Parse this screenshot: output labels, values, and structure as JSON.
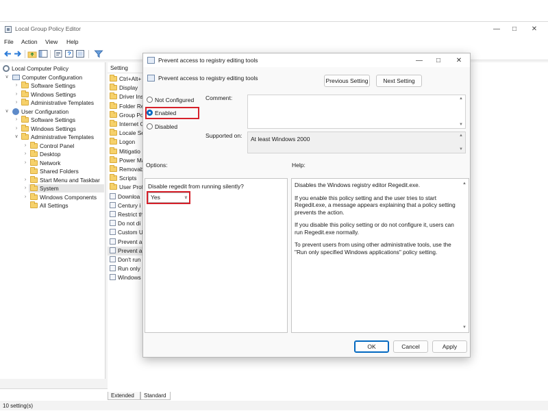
{
  "window": {
    "title": "Local Group Policy Editor",
    "menus": [
      "File",
      "Action",
      "View",
      "Help"
    ],
    "status": "10 setting(s)"
  },
  "tree": {
    "root": "Local Computer Policy",
    "computer": "Computer Configuration",
    "computer_children": [
      "Software Settings",
      "Windows Settings",
      "Administrative Templates"
    ],
    "user": "User Configuration",
    "user_children": [
      "Software Settings",
      "Windows Settings",
      "Administrative Templates"
    ],
    "admin_children": [
      "Control Panel",
      "Desktop",
      "Network",
      "Shared Folders",
      "Start Menu and Taskbar",
      "System",
      "Windows Components",
      "All Settings"
    ]
  },
  "list": {
    "header": "Setting",
    "folders": [
      "Ctrl+Alt+",
      "Display",
      "Driver Ins",
      "Folder Re",
      "Group Po",
      "Internet C",
      "Locale Se",
      "Logon",
      "Mitigatio",
      "Power Ma",
      "Removab",
      "Scripts",
      "User Profi"
    ],
    "settings": [
      "Downloa",
      "Century i",
      "Restrict th",
      "Do not di",
      "Custom U",
      "Prevent a",
      "Prevent a",
      "Don't run",
      "Run only",
      "Windows"
    ]
  },
  "tabs": [
    "Extended",
    "Standard"
  ],
  "dialog": {
    "title": "Prevent access to registry editing tools",
    "header_label": "Prevent access to registry editing tools",
    "prev_button": "Previous Setting",
    "next_button": "Next Setting",
    "radio_not_configured": "Not Configured",
    "radio_enabled": "Enabled",
    "radio_disabled": "Disabled",
    "comment_label": "Comment:",
    "supported_label": "Supported on:",
    "supported_value": "At least Windows 2000",
    "options_label": "Options:",
    "help_label": "Help:",
    "option_text": "Disable regedit from running silently?",
    "option_value": "Yes",
    "help_paragraphs": [
      "Disables the Windows registry editor Regedit.exe.",
      "If you enable this policy setting and the user tries to start Regedit.exe, a message appears explaining that a policy setting prevents the action.",
      "If you disable this policy setting or do not configure it, users can run Regedit.exe normally.",
      "To prevent users from using other administrative tools, use the \"Run only specified Windows applications\" policy setting."
    ],
    "ok": "OK",
    "cancel": "Cancel",
    "apply": "Apply"
  },
  "colors": {
    "accent": "#0067c0",
    "highlight": "#d6202a",
    "folder": "#f6d16b"
  }
}
